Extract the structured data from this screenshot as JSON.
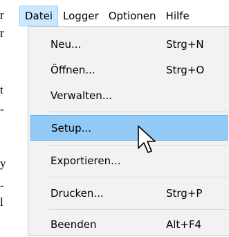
{
  "menubar": {
    "items": [
      {
        "label": "Datei"
      },
      {
        "label": "Logger"
      },
      {
        "label": "Optionen"
      },
      {
        "label": "Hilfe"
      }
    ]
  },
  "dropdown": {
    "items": [
      {
        "label": "Neu...",
        "shortcut": "Strg+N"
      },
      {
        "label": "Öffnen...",
        "shortcut": "Strg+O"
      },
      {
        "label": "Verwalten...",
        "shortcut": ""
      },
      {
        "label": "Setup...",
        "shortcut": ""
      },
      {
        "label": "Exportieren...",
        "shortcut": ""
      },
      {
        "label": "Drucken...",
        "shortcut": "Strg+P"
      },
      {
        "label": "Beenden",
        "shortcut": "Alt+F4"
      }
    ]
  },
  "background_fragments": [
    {
      "text": "r"
    },
    {
      "text": "r"
    },
    {
      "text": "t"
    },
    {
      "text": "-"
    },
    {
      "text": "y"
    },
    {
      "text": "-"
    },
    {
      "text": "l"
    }
  ],
  "colors": {
    "menu_active_bg": "#cce8ff",
    "item_highlight_bg": "#91c9f7",
    "dropdown_bg": "#f2f2f2"
  }
}
